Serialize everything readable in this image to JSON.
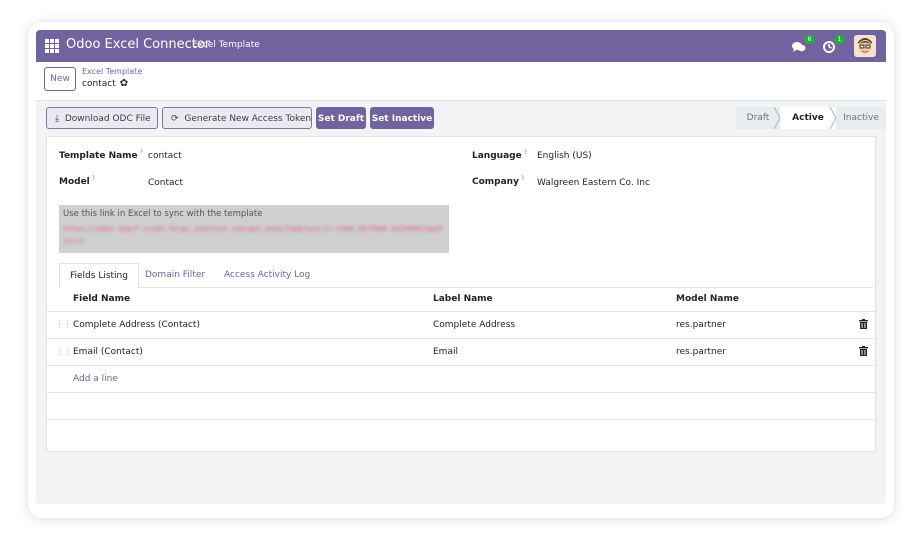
{
  "navbar": {
    "app_name": "Odoo Excel Connector",
    "menu_item": "Excel Template",
    "messages_count": "6",
    "activities_count": "1",
    "brand_color": "#71639e"
  },
  "control": {
    "new_label": "New",
    "breadcrumb_parent": "Excel Template",
    "breadcrumb_current": "contact",
    "gear_glyph": "✿"
  },
  "statusbar": {
    "download_label": "Download ODC File",
    "generate_token_label": "Generate New Access Token",
    "set_draft_label": "Set Draft",
    "set_inactive_label": "Set Inactive",
    "download_icon_glyph": "⤓",
    "generate_icon_glyph": "⟳",
    "stages": [
      "Draft",
      "Active",
      "Inactive"
    ],
    "current_stage": "Active"
  },
  "form": {
    "template_name_label": "Template Name",
    "template_name_value": "contact",
    "model_label": "Model",
    "model_value": "Contact",
    "language_label": "Language",
    "language_value": "English (US)",
    "company_label": "Company",
    "company_value": "Walgreen Eastern Co. Inc",
    "help_mark": "?",
    "link_hint": "Use this link in Excel to sync with the template",
    "link_url": "https://odoo-obpcf.ica34.forge.sehntech.com/get_data/template/1/-CAAK_XRJfN9k-kaZ4PGklogeP1iclu"
  },
  "tabs": [
    "Fields Listing",
    "Domain Filter",
    "Access Activity Log"
  ],
  "table": {
    "columns": [
      "Field Name",
      "Label Name",
      "Model Name"
    ],
    "rows": [
      {
        "field": "Complete Address (Contact)",
        "label": "Complete Address",
        "model": "res.partner"
      },
      {
        "field": "Email (Contact)",
        "label": "Email",
        "model": "res.partner"
      }
    ],
    "add_line": "Add a line"
  }
}
